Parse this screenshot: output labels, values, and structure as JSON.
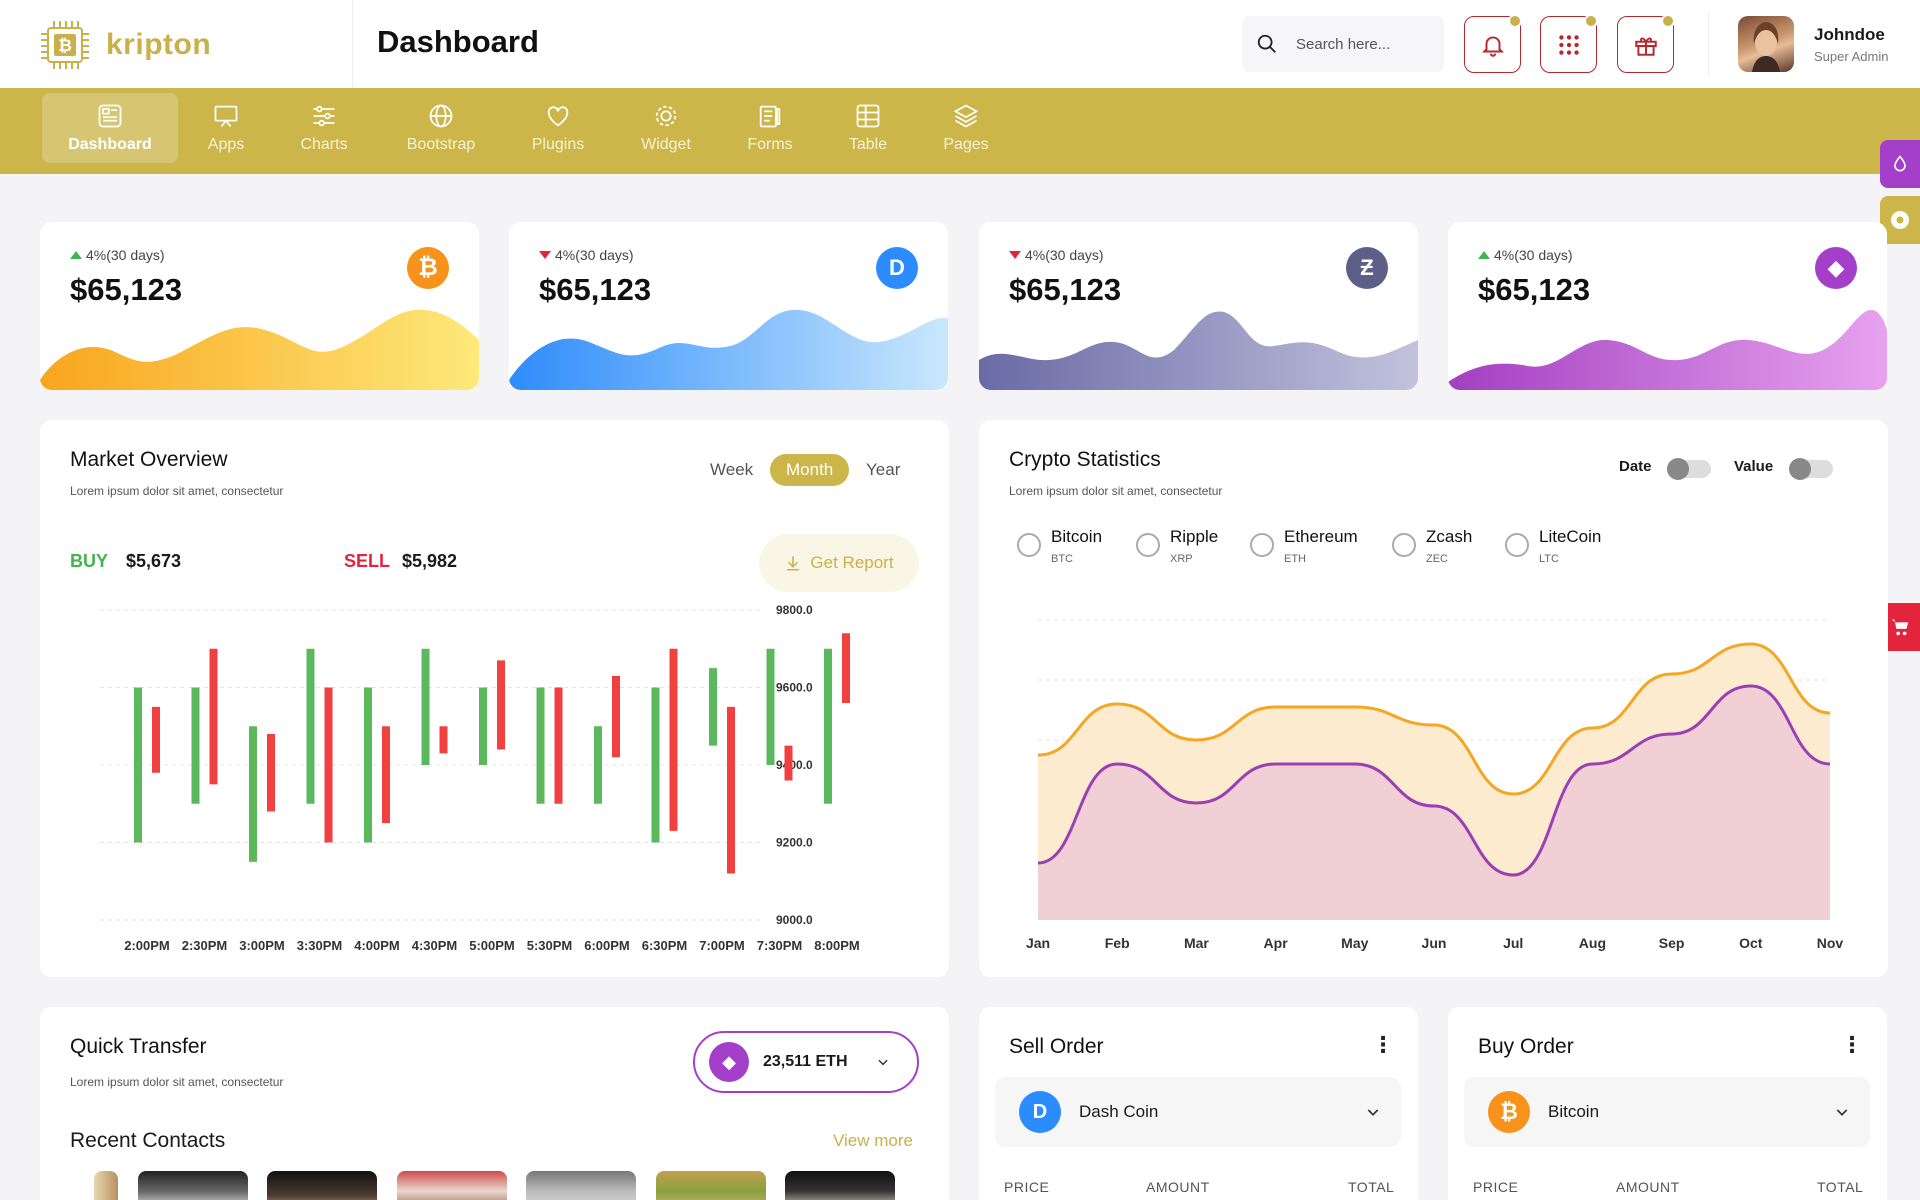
{
  "brand": {
    "name": "kripton",
    "color": "#ccb64a"
  },
  "header": {
    "title": "Dashboard",
    "search_placeholder": "Search here...",
    "user_name": "Johndoe",
    "user_role": "Super Admin"
  },
  "nav": [
    {
      "label": "Dashboard",
      "icon": "dashboard-icon",
      "active": true
    },
    {
      "label": "Apps",
      "icon": "monitor-icon"
    },
    {
      "label": "Charts",
      "icon": "sliders-icon"
    },
    {
      "label": "Bootstrap",
      "icon": "globe-icon"
    },
    {
      "label": "Plugins",
      "icon": "heart-icon"
    },
    {
      "label": "Widget",
      "icon": "gear-icon"
    },
    {
      "label": "Forms",
      "icon": "clipboard-icon"
    },
    {
      "label": "Table",
      "icon": "table-icon"
    },
    {
      "label": "Pages",
      "icon": "layers-icon"
    }
  ],
  "stats": [
    {
      "change": "4%(30 days)",
      "direction": "up",
      "value": "$65,123",
      "coin": "bitcoin-icon",
      "color": "#f7931a"
    },
    {
      "change": "4%(30 days)",
      "direction": "down",
      "value": "$65,123",
      "coin": "dash-icon",
      "color": "#2b8cff"
    },
    {
      "change": "4%(30 days)",
      "direction": "down",
      "value": "$65,123",
      "coin": "zcash-icon",
      "color": "#5d5f88"
    },
    {
      "change": "4%(30 days)",
      "direction": "up",
      "value": "$65,123",
      "coin": "ethereum-icon",
      "color": "#a43fc9"
    }
  ],
  "market": {
    "title": "Market Overview",
    "subtitle": "Lorem ipsum dolor sit amet, consectetur",
    "periods": [
      "Week",
      "Month",
      "Year"
    ],
    "active_period": "Month",
    "buy_label": "BUY",
    "buy_value": "$5,673",
    "sell_label": "SELL",
    "sell_value": "$5,982",
    "report_label": "Get Report"
  },
  "crypto": {
    "title": "Crypto Statistics",
    "subtitle": "Lorem ipsum dolor sit amet, consectetur",
    "toggle_date": "Date",
    "toggle_value": "Value",
    "coins": [
      {
        "name": "Bitcoin",
        "code": "BTC"
      },
      {
        "name": "Ripple",
        "code": "XRP"
      },
      {
        "name": "Ethereum",
        "code": "ETH"
      },
      {
        "name": "Zcash",
        "code": "ZEC"
      },
      {
        "name": "LiteCoin",
        "code": "LTC"
      }
    ]
  },
  "transfer": {
    "title": "Quick Transfer",
    "subtitle": "Lorem ipsum dolor sit amet, consectetur",
    "amount": "23,511 ETH",
    "recent_title": "Recent Contacts",
    "view_more": "View more"
  },
  "sell_order": {
    "title": "Sell Order",
    "coin": "Dash Coin",
    "cols": [
      "PRICE",
      "AMOUNT",
      "TOTAL"
    ]
  },
  "buy_order": {
    "title": "Buy Order",
    "coin": "Bitcoin",
    "cols": [
      "PRICE",
      "AMOUNT",
      "TOTAL"
    ]
  },
  "chart_data": [
    {
      "type": "candlestick",
      "title": "Market Overview",
      "x": [
        "2:00PM",
        "2:30PM",
        "3:00PM",
        "3:30PM",
        "4:00PM",
        "4:30PM",
        "5:00PM",
        "5:30PM",
        "6:00PM",
        "6:30PM",
        "7:00PM",
        "7:30PM",
        "8:00PM"
      ],
      "ylim": [
        9000,
        9800
      ],
      "y_ticks": [
        "9800.0",
        "9600.0",
        "9400.0",
        "9200.0",
        "9000.0"
      ],
      "series": [
        {
          "name": "up",
          "color": "#5cb85c",
          "bars": [
            [
              9200,
              9600
            ],
            [
              9300,
              9600
            ],
            [
              9150,
              9500
            ],
            [
              9300,
              9700
            ],
            [
              9200,
              9600
            ],
            [
              9400,
              9700
            ],
            [
              9400,
              9600
            ],
            [
              9300,
              9600
            ],
            [
              9300,
              9500
            ],
            [
              9200,
              9600
            ],
            [
              9450,
              9650
            ],
            [
              9400,
              9700
            ],
            [
              9300,
              9700
            ]
          ]
        },
        {
          "name": "down",
          "color": "#f04040",
          "bars": [
            [
              9380,
              9550
            ],
            [
              9350,
              9700
            ],
            [
              9280,
              9480
            ],
            [
              9200,
              9600
            ],
            [
              9250,
              9500
            ],
            [
              9430,
              9500
            ],
            [
              9440,
              9670
            ],
            [
              9300,
              9600
            ],
            [
              9420,
              9630
            ],
            [
              9230,
              9700
            ],
            [
              9120,
              9550
            ],
            [
              9360,
              9450
            ],
            [
              9560,
              9740
            ]
          ]
        }
      ]
    },
    {
      "type": "area",
      "title": "Crypto Statistics",
      "categories": [
        "Jan",
        "Feb",
        "Mar",
        "Apr",
        "May",
        "Jun",
        "Jul",
        "Aug",
        "Sep",
        "Oct",
        "Nov"
      ],
      "series": [
        {
          "color": "#f5a623",
          "fill": "#fdebd0",
          "values": [
            55,
            72,
            60,
            71,
            71,
            65,
            42,
            64,
            82,
            92,
            69
          ]
        },
        {
          "color": "#9b3fb5",
          "fill": "#eecdd4",
          "values": [
            19,
            52,
            39,
            52,
            52,
            38,
            15,
            52,
            62,
            78,
            52
          ]
        }
      ]
    }
  ]
}
